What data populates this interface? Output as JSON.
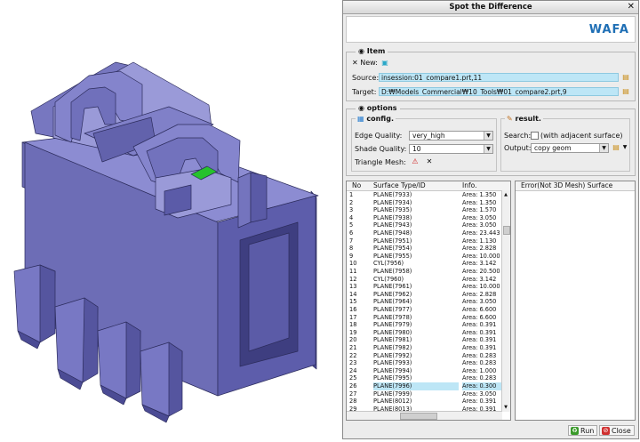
{
  "dialog": {
    "title": "Spot the Difference",
    "close_glyph": "✕",
    "logo": "WAFA"
  },
  "item": {
    "header": "Item",
    "new_label": "New:",
    "source_label": "Source:",
    "source_value": "insession:01_compare1.prt,11",
    "target_label": "Target:",
    "target_value": "D:₩Models_Commercial₩10_Tools₩01_compare2.prt,9"
  },
  "options": {
    "header": "options",
    "config": {
      "header": "config.",
      "edge_quality_label": "Edge Quality:",
      "edge_quality_value": "very_high",
      "shade_quality_label": "Shade Quality:",
      "shade_quality_value": "10",
      "triangle_mesh_label": "Triangle Mesh:"
    },
    "result": {
      "header": "result.",
      "search_label": "Search:",
      "search_hint": "(with adjacent surface)",
      "output_label": "Output:",
      "output_value": "copy geom"
    }
  },
  "table": {
    "headers": [
      "No",
      "Surface Type/ID",
      "Info."
    ],
    "selected_index": 25,
    "rows": [
      [
        "1",
        "PLANE(7933)",
        "Area: 1.350"
      ],
      [
        "2",
        "PLANE(7934)",
        "Area: 1.350"
      ],
      [
        "3",
        "PLANE(7935)",
        "Area: 1.570"
      ],
      [
        "4",
        "PLANE(7938)",
        "Area: 3.050"
      ],
      [
        "5",
        "PLANE(7943)",
        "Area: 3.050"
      ],
      [
        "6",
        "PLANE(7948)",
        "Area: 23.443"
      ],
      [
        "7",
        "PLANE(7951)",
        "Area: 1.130"
      ],
      [
        "8",
        "PLANE(7954)",
        "Area: 2.828"
      ],
      [
        "9",
        "PLANE(7955)",
        "Area: 10.000"
      ],
      [
        "10",
        "CYL(7956)",
        "Area: 3.142"
      ],
      [
        "11",
        "PLANE(7958)",
        "Area: 20.500"
      ],
      [
        "12",
        "CYL(7960)",
        "Area: 3.142"
      ],
      [
        "13",
        "PLANE(7961)",
        "Area: 10.000"
      ],
      [
        "14",
        "PLANE(7962)",
        "Area: 2.828"
      ],
      [
        "15",
        "PLANE(7964)",
        "Area: 3.050"
      ],
      [
        "16",
        "PLANE(7977)",
        "Area: 6.600"
      ],
      [
        "17",
        "PLANE(7978)",
        "Area: 6.600"
      ],
      [
        "18",
        "PLANE(7979)",
        "Area: 0.391"
      ],
      [
        "19",
        "PLANE(7980)",
        "Area: 0.391"
      ],
      [
        "20",
        "PLANE(7981)",
        "Area: 0.391"
      ],
      [
        "21",
        "PLANE(7982)",
        "Area: 0.391"
      ],
      [
        "22",
        "PLANE(7992)",
        "Area: 0.283"
      ],
      [
        "23",
        "PLANE(7993)",
        "Area: 0.283"
      ],
      [
        "24",
        "PLANE(7994)",
        "Area: 1.000"
      ],
      [
        "25",
        "PLANE(7995)",
        "Area: 0.283"
      ],
      [
        "26",
        "PLANE(7996)",
        "Area: 0.300"
      ],
      [
        "27",
        "PLANE(7999)",
        "Area: 3.050"
      ],
      [
        "28",
        "PLANE(8012)",
        "Area: 0.391"
      ],
      [
        "29",
        "PLANE(8013)",
        "Area: 0.391"
      ]
    ],
    "error_header": "Error(Not 3D Mesh) Surface"
  },
  "buttons": {
    "run": "Run",
    "close": "Close"
  },
  "colors": {
    "model_face": "#6a6ab2",
    "model_side": "#4b4b94",
    "model_top": "#8c8cd2",
    "highlight": "#26c22c",
    "field_bg": "#bde6f6",
    "logo": "#1f6fb5"
  }
}
